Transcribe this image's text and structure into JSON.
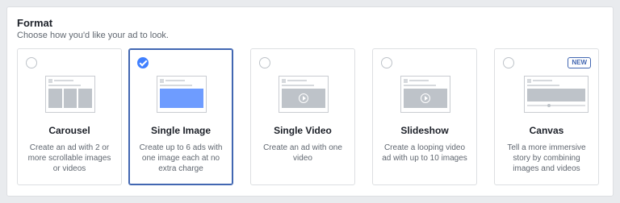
{
  "format": {
    "title": "Format",
    "subtitle": "Choose how you'd like your ad to look."
  },
  "cards": [
    {
      "title": "Carousel",
      "description": "Create an ad with 2 or more scrollable images or videos",
      "selected": false,
      "icon": "carousel-preview-icon"
    },
    {
      "title": "Single Image",
      "description": "Create up to 6 ads with one image each at no extra charge",
      "selected": true,
      "icon": "single-image-preview-icon"
    },
    {
      "title": "Single Video",
      "description": "Create an ad with one video",
      "selected": false,
      "icon": "single-video-preview-icon"
    },
    {
      "title": "Slideshow",
      "description": "Create a looping video ad with up to 10 images",
      "selected": false,
      "icon": "slideshow-preview-icon"
    },
    {
      "title": "Canvas",
      "description": "Tell a more immersive story by combining images and videos",
      "selected": false,
      "icon": "canvas-preview-icon",
      "badge": "NEW"
    }
  ],
  "colors": {
    "accent": "#4267b2",
    "check": "#4080ff"
  }
}
